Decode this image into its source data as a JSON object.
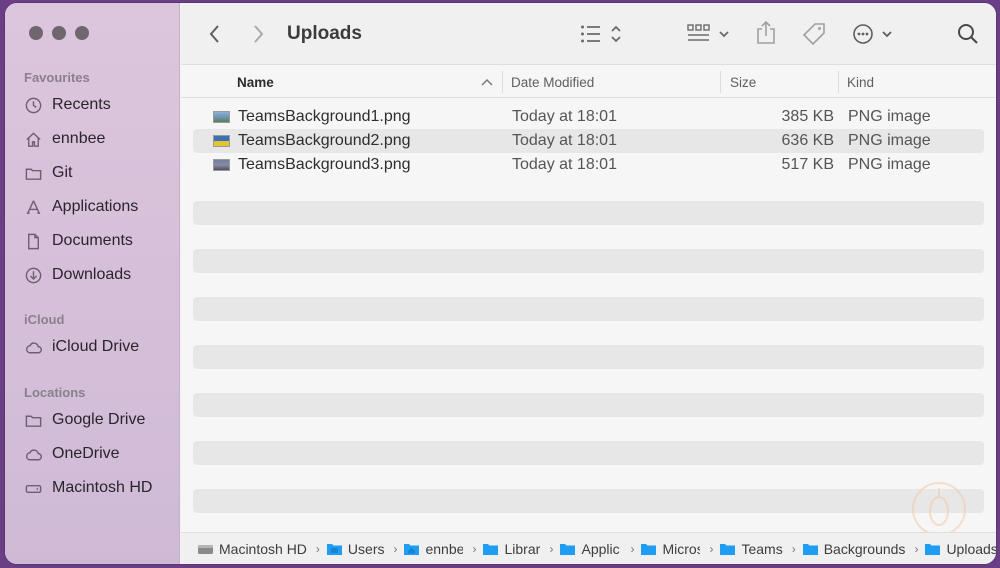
{
  "window": {
    "title": "Uploads"
  },
  "sidebar": {
    "sections": [
      {
        "title": "Favourites",
        "items": [
          {
            "label": "Recents",
            "icon": "clock-icon"
          },
          {
            "label": "ennbee",
            "icon": "home-icon"
          },
          {
            "label": "Git",
            "icon": "folder-icon"
          },
          {
            "label": "Applications",
            "icon": "applications-icon"
          },
          {
            "label": "Documents",
            "icon": "document-icon"
          },
          {
            "label": "Downloads",
            "icon": "download-icon"
          }
        ]
      },
      {
        "title": "iCloud",
        "items": [
          {
            "label": "iCloud Drive",
            "icon": "cloud-icon"
          }
        ]
      },
      {
        "title": "Locations",
        "items": [
          {
            "label": "Google Drive",
            "icon": "folder-icon"
          },
          {
            "label": "OneDrive",
            "icon": "cloud-icon"
          },
          {
            "label": "Macintosh HD",
            "icon": "drive-icon"
          }
        ]
      }
    ]
  },
  "columns": {
    "name": "Name",
    "date": "Date Modified",
    "size": "Size",
    "kind": "Kind"
  },
  "files": [
    {
      "name": "TeamsBackground1.png",
      "date": "Today at 18:01",
      "size": "385 KB",
      "kind": "PNG image"
    },
    {
      "name": "TeamsBackground2.png",
      "date": "Today at 18:01",
      "size": "636 KB",
      "kind": "PNG image"
    },
    {
      "name": "TeamsBackground3.png",
      "date": "Today at 18:01",
      "size": "517 KB",
      "kind": "PNG image"
    }
  ],
  "path": [
    {
      "label": "Macintosh HD",
      "icon": "drive-icon"
    },
    {
      "label": "Users",
      "icon": "folder-icon"
    },
    {
      "label": "ennbe",
      "icon": "home-folder-icon"
    },
    {
      "label": "Librar",
      "icon": "folder-icon"
    },
    {
      "label": "Applic",
      "icon": "folder-icon"
    },
    {
      "label": "Micros",
      "icon": "folder-icon"
    },
    {
      "label": "Teams",
      "icon": "folder-icon"
    },
    {
      "label": "Backgrounds",
      "icon": "folder-icon"
    },
    {
      "label": "Uploads",
      "icon": "folder-icon"
    }
  ],
  "colors": {
    "accent_folder": "#1f9df2",
    "sidebar_bg": "#d8c2da",
    "background": "#6a3f86"
  }
}
